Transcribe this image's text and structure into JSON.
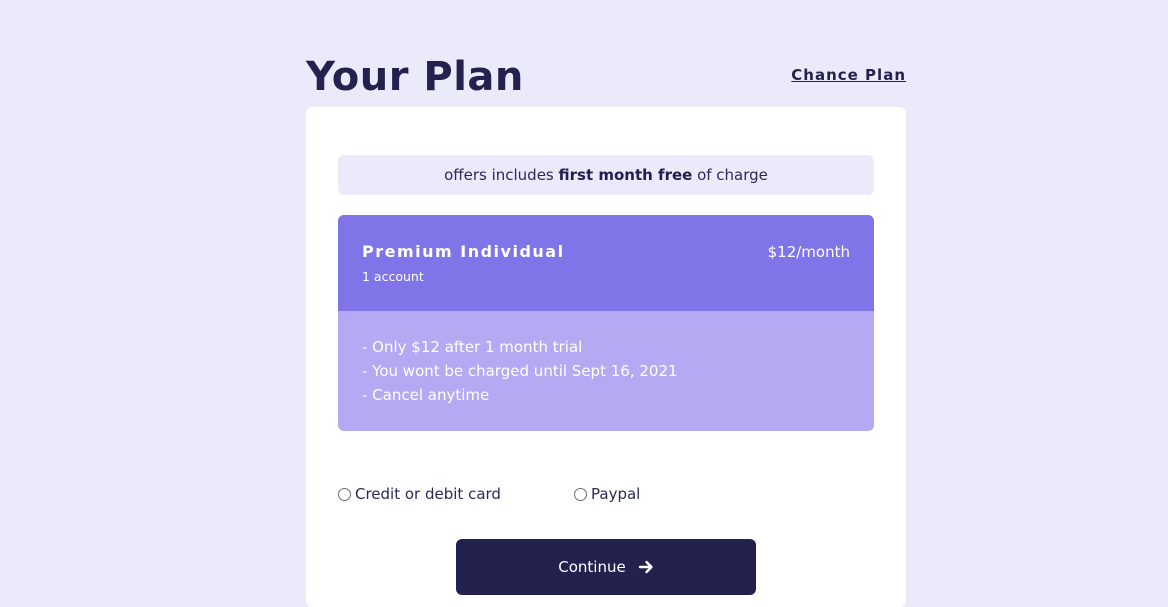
{
  "header": {
    "title": "Your Plan",
    "change_link": "Chance Plan"
  },
  "offer": {
    "prefix": "offers includes ",
    "highlight": "first month free",
    "suffix": " of charge"
  },
  "plan": {
    "name": "Premium Individual",
    "accounts": "1 account",
    "price": "$12/month",
    "features": [
      "- Only $12 after 1 month trial",
      "- You wont be charged until Sept 16, 2021",
      "- Cancel anytime"
    ]
  },
  "payment": {
    "options": [
      "Credit or debit card",
      "Paypal"
    ]
  },
  "actions": {
    "continue_label": "Continue",
    "continue_icon": "arrow-right-icon"
  },
  "colors": {
    "background": "#ebeafa",
    "primary_dark": "#23224f",
    "plan_header": "#7f75e8",
    "plan_body": "#b5a9f3"
  }
}
